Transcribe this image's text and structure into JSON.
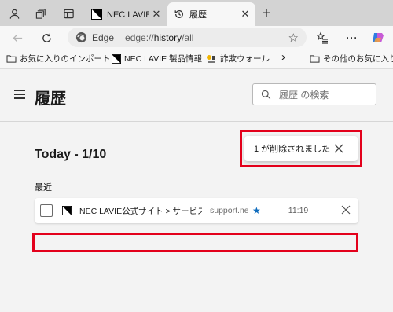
{
  "browser": {
    "tabs": [
      {
        "title": "NEC LAVIE公式",
        "favicon": "nec-favicon",
        "active": false
      },
      {
        "title": "履歴",
        "favicon": "history-icon",
        "active": true
      }
    ],
    "address": {
      "brand": "Edge",
      "url_scheme": "edge://",
      "url_host": "history",
      "url_path": "/all"
    },
    "favorites_bar": {
      "items": [
        {
          "label": "お気に入りのインポート",
          "icon": "folder-icon"
        },
        {
          "label": "NEC LAVIE 製品情報",
          "icon": "nec-favicon"
        },
        {
          "label": "詐欺ウォール",
          "icon": "scam-wall-icon"
        }
      ],
      "more_label": "›",
      "other_label": "その他のお気に入り"
    }
  },
  "page": {
    "title": "履歴",
    "search_placeholder": "履歴 の検索",
    "date_heading": "Today - 1/10",
    "section_label": "最近",
    "entries": [
      {
        "title": "NEC LAVIE公式サイト > サービス＆サポート",
        "domain": "support.nec-lavie.jp",
        "time": "11:19",
        "favorited": true
      }
    ],
    "toast": {
      "message": "1 が削除されました"
    }
  },
  "colors": {
    "highlight": "#e3001b",
    "star": "#0f6cbd",
    "tab_strip": "#d3d3d3"
  }
}
